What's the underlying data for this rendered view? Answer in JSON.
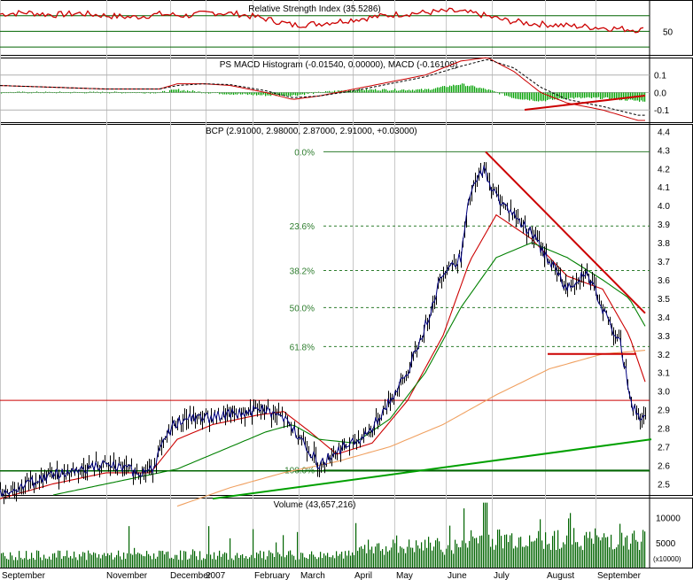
{
  "chart_data": [
    {
      "type": "line",
      "panel": "rsi",
      "title": "Relative Strength Index (35.5286)",
      "yticks": [
        "50"
      ],
      "ylim": [
        20,
        90
      ],
      "reference_levels": [
        70,
        50,
        30
      ],
      "series": [
        {
          "name": "Relative Strength Index",
          "color": "#cc0000",
          "x": [
            0,
            30,
            60,
            90,
            120,
            150,
            180,
            210,
            240,
            270,
            300,
            330,
            360,
            390,
            420,
            450,
            480,
            510,
            540,
            570,
            600,
            630,
            660,
            690,
            720
          ],
          "values": [
            72,
            74,
            71,
            73,
            70,
            68,
            72,
            70,
            74,
            72,
            66,
            58,
            60,
            64,
            68,
            72,
            74,
            76,
            72,
            64,
            60,
            58,
            56,
            54,
            52
          ]
        }
      ]
    },
    {
      "type": "bar",
      "panel": "macd",
      "title": "PS MACD Histogram (-0.01540, 0.00000), MACD (-0.16108)",
      "yticks": [
        "0.1",
        "0.0",
        "-0.1"
      ],
      "ylim": [
        -0.17,
        0.2
      ],
      "series": [
        {
          "name": "MACD",
          "color": "#cc0000",
          "x": [
            0,
            60,
            120,
            180,
            200,
            230,
            260,
            300,
            330,
            360,
            400,
            440,
            480,
            520,
            550,
            580,
            610,
            640,
            680,
            720
          ],
          "values": [
            0.04,
            0.03,
            0.02,
            0.02,
            0.05,
            0.05,
            0.04,
            0.0,
            -0.04,
            -0.02,
            0.02,
            0.06,
            0.1,
            0.18,
            0.2,
            0.12,
            0.0,
            -0.06,
            -0.1,
            -0.16
          ]
        },
        {
          "name": "Signal",
          "color": "#000000",
          "x": [
            0,
            60,
            120,
            180,
            200,
            230,
            260,
            300,
            330,
            360,
            400,
            440,
            480,
            520,
            550,
            580,
            610,
            640,
            680,
            720
          ],
          "values": [
            0.04,
            0.03,
            0.02,
            0.02,
            0.04,
            0.05,
            0.045,
            0.01,
            -0.03,
            -0.02,
            0.01,
            0.05,
            0.09,
            0.15,
            0.19,
            0.14,
            0.03,
            -0.04,
            -0.08,
            -0.13
          ]
        }
      ]
    },
    {
      "type": "line",
      "panel": "price",
      "title": "BCP (2.91000, 2.98000, 2.87000, 2.91000, +0.03000)",
      "y_axis_side": "right",
      "yticks": [
        "4.4",
        "4.3",
        "4.2",
        "4.1",
        "4.0",
        "3.9",
        "3.8",
        "3.7",
        "3.6",
        "3.5",
        "3.4",
        "3.3",
        "3.2",
        "3.1",
        "3.0",
        "2.9",
        "2.8",
        "2.7",
        "2.6",
        "2.5"
      ],
      "ylim": [
        2.44,
        4.44
      ],
      "fibonacci": [
        {
          "label": "0.0%",
          "price": 4.29
        },
        {
          "label": "23.6%",
          "price": 3.89
        },
        {
          "label": "38.2%",
          "price": 3.65
        },
        {
          "label": "50.0%",
          "price": 3.45
        },
        {
          "label": "61.8%",
          "price": 3.24
        },
        {
          "label": "100.0%",
          "price": 2.575
        }
      ],
      "horizontal_lines": [
        2.95,
        2.57
      ],
      "series": [
        {
          "name": "BCP",
          "color": "#000080",
          "x": [
            0,
            30,
            60,
            90,
            120,
            150,
            170,
            195,
            210,
            240,
            270,
            300,
            320,
            340,
            360,
            380,
            400,
            420,
            440,
            460,
            480,
            500,
            520,
            530,
            545,
            560,
            580,
            600,
            620,
            640,
            660,
            680,
            700,
            715,
            725
          ],
          "values": [
            2.45,
            2.5,
            2.55,
            2.58,
            2.6,
            2.57,
            2.57,
            2.82,
            2.85,
            2.86,
            2.88,
            2.9,
            2.85,
            2.75,
            2.6,
            2.68,
            2.72,
            2.8,
            2.95,
            3.1,
            3.35,
            3.65,
            3.72,
            4.05,
            4.2,
            4.05,
            3.95,
            3.85,
            3.7,
            3.55,
            3.65,
            3.45,
            3.25,
            2.9,
            2.85
          ]
        },
        {
          "name": "MA short",
          "color": "#cc0000",
          "x": [
            0,
            60,
            120,
            170,
            200,
            240,
            290,
            320,
            350,
            380,
            420,
            460,
            500,
            530,
            560,
            600,
            640,
            680,
            710,
            728
          ],
          "values": [
            2.42,
            2.5,
            2.56,
            2.56,
            2.74,
            2.82,
            2.87,
            2.89,
            2.78,
            2.66,
            2.72,
            2.95,
            3.3,
            3.7,
            3.95,
            3.82,
            3.62,
            3.55,
            3.3,
            3.05
          ]
        },
        {
          "name": "MA medium",
          "color": "#008000",
          "x": [
            60,
            120,
            170,
            200,
            250,
            300,
            330,
            360,
            400,
            440,
            480,
            520,
            560,
            600,
            640,
            680,
            710,
            728
          ],
          "values": [
            2.44,
            2.5,
            2.55,
            2.58,
            2.68,
            2.78,
            2.82,
            2.74,
            2.72,
            2.85,
            3.1,
            3.45,
            3.72,
            3.8,
            3.72,
            3.6,
            3.5,
            3.35
          ]
        },
        {
          "name": "MA long",
          "color": "#f0a060",
          "x": [
            200,
            260,
            320,
            380,
            440,
            500,
            560,
            620,
            680,
            728
          ],
          "values": [
            2.38,
            2.48,
            2.56,
            2.62,
            2.7,
            2.82,
            2.98,
            3.12,
            3.2,
            3.22
          ]
        }
      ],
      "trendlines": [
        {
          "color": "#cc0000",
          "from": {
            "x": 548,
            "y": 4.29
          },
          "to": {
            "x": 728,
            "y": 3.42
          }
        },
        {
          "color": "#cc0000",
          "from": {
            "x": 618,
            "y": 3.2
          },
          "to": {
            "x": 718,
            "y": 3.2
          }
        },
        {
          "color": "#00a000",
          "from": {
            "x": 240,
            "y": 2.42
          },
          "to": {
            "x": 735,
            "y": 2.74
          }
        }
      ]
    },
    {
      "type": "bar",
      "panel": "volume",
      "title": "Volume (43,657,216)",
      "yticks": [
        "10000",
        "5000"
      ],
      "unit_label": "(x10000)",
      "ylim": [
        0,
        14000
      ]
    }
  ],
  "x_axis": {
    "labels": [
      "September",
      "November",
      "December",
      "2007",
      "February",
      "March",
      "April",
      "May",
      "June",
      "July",
      "August",
      "September"
    ]
  },
  "colors": {
    "grid": "#b0b0b0",
    "background": "#ffffff",
    "price_line": "#000080",
    "volume": "#006400",
    "histogram": "#00a000"
  }
}
